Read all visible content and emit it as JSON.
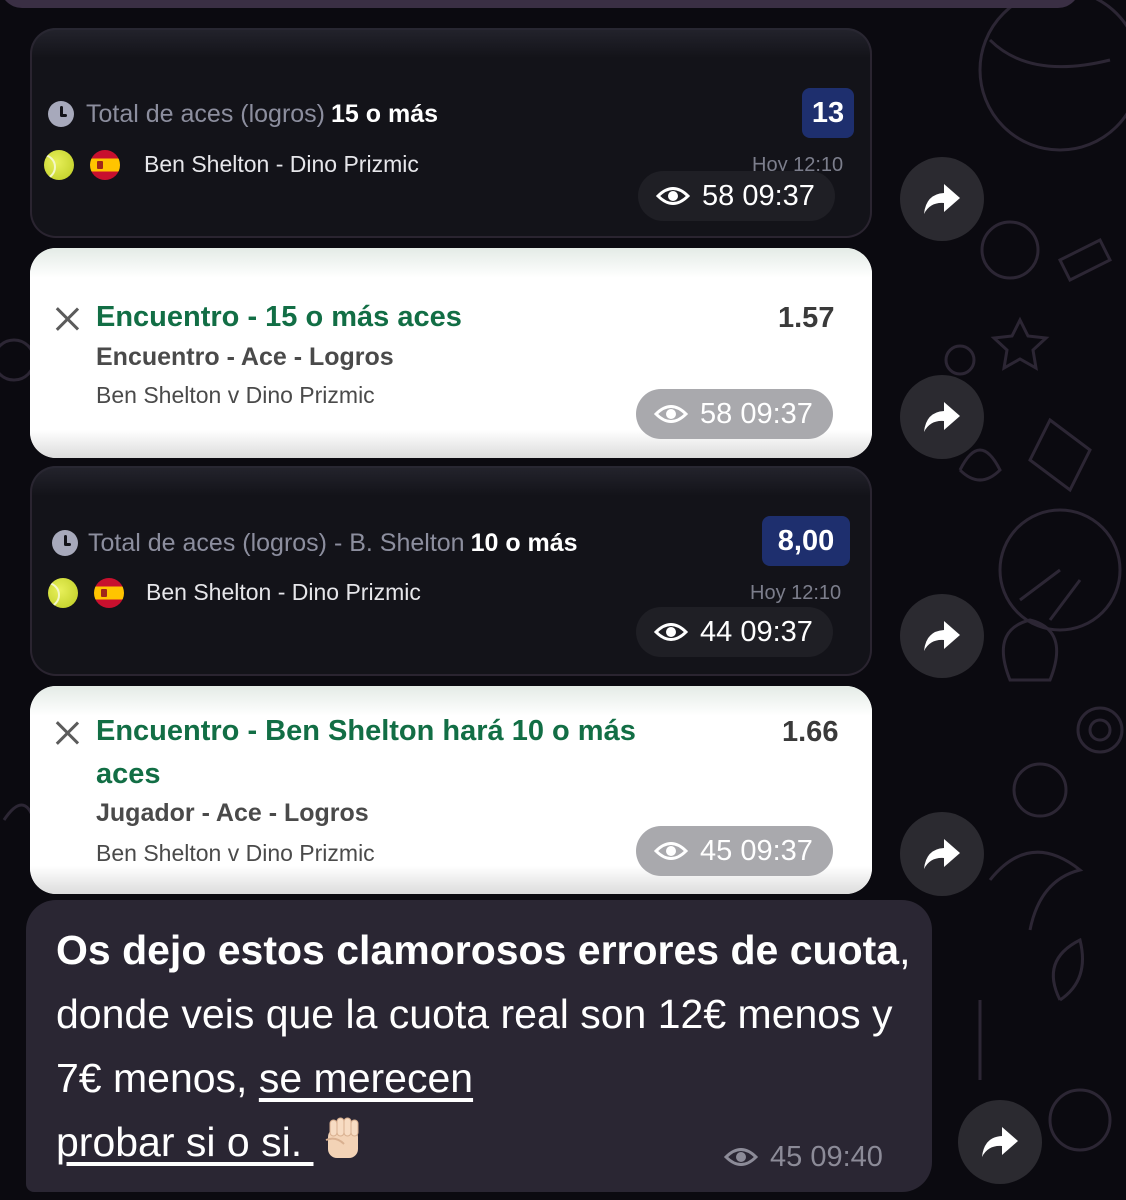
{
  "cards": [
    {
      "type": "market",
      "market_prefix": "Total de aces (logros)",
      "market_value": "15 o más",
      "odds": "13",
      "players": "Ben Shelton - Dino Prizmic",
      "date": "Hoy 12:10",
      "views": "58",
      "time": "09:37"
    },
    {
      "type": "slip",
      "title": "Encuentro - 15 o más aces",
      "odds": "1.57",
      "market": "Encuentro - Ace - Logros",
      "event": "Ben Shelton v Dino Prizmic",
      "views": "58",
      "time": "09:37"
    },
    {
      "type": "market",
      "market_prefix": "Total de aces (logros) - B. Shelton",
      "market_value": "10 o más",
      "odds": "8,00",
      "players": "Ben Shelton - Dino Prizmic",
      "date": "Hoy 12:10",
      "views": "44",
      "time": "09:37"
    },
    {
      "type": "slip",
      "title_line1": "Encuentro - Ben Shelton hará 10 o más",
      "title_line2": "aces",
      "odds": "1.66",
      "market": "Jugador - Ace - Logros",
      "event": "Ben Shelton v Dino Prizmic",
      "views": "45",
      "time": "09:37"
    }
  ],
  "message": {
    "bold_part": "Os dejo estos clamorosos errores de cuota",
    "normal_part": ", donde veis que la cuota real son 12€ menos y 7€ menos, ",
    "underlined_part_1": "se merecen",
    "underlined_part_2": "probar si o si. ",
    "emoji": "raised-fist",
    "views": "45",
    "time": "09:40"
  },
  "colors": {
    "slip_green": "#126e45",
    "odds_badge": "#1e2f6e",
    "message_bubble": "#2a2633"
  }
}
